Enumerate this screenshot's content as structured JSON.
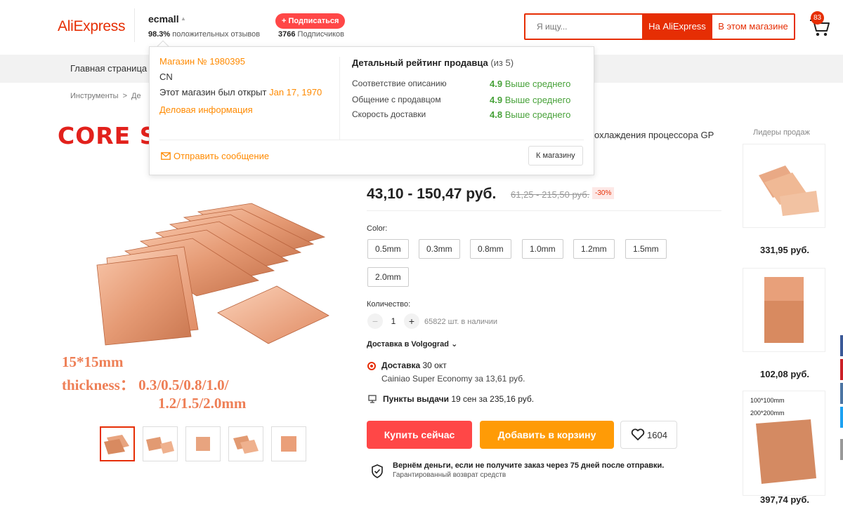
{
  "header": {
    "logo": "AliExpress",
    "store_name": "ecmall",
    "store_rating_value": "98.3%",
    "store_rating_label": "положительных отзывов",
    "subscribe_label": "+ Подписаться",
    "subscribers_value": "3766",
    "subscribers_label": "Подписчиков",
    "search_placeholder": "Я ищу...",
    "search_aliexpress": "На AliExpress",
    "search_store": "В этом магазине",
    "cart_count": "83"
  },
  "nav": {
    "home": "Главная страница"
  },
  "breadcrumb": {
    "item1": "Инструменты",
    "sep": ">",
    "item2": "Де"
  },
  "gallery": {
    "banner_text": "CORE SU",
    "text1": "15*15mm",
    "text2": "thickness： 0.3/0.5/0.8/1.0/",
    "text3": "1.2/1.5/2.0mm"
  },
  "product": {
    "title_partial": "охлаждения процессора GP",
    "price": "43,10 - 150,47 руб.",
    "price_old": "61,25 - 215,50 руб.",
    "discount": "-30%",
    "color_label": "Color:",
    "options": [
      "0.5mm",
      "0.3mm",
      "0.8mm",
      "1.0mm",
      "1.2mm",
      "1.5mm",
      "2.0mm"
    ],
    "qty_label": "Количество:",
    "qty_minus": "−",
    "qty_value": "1",
    "qty_plus": "+",
    "stock": "65822 шт. в наличии",
    "ship_to": "Доставка в Volgograd",
    "ship_title": "Доставка",
    "ship_date": "30 окт",
    "ship_method": "Cainiao Super Economy за 13,61 руб.",
    "pickup_title": "Пункты выдачи",
    "pickup_detail": "19 сен за 235,16 руб.",
    "buy_now": "Купить сейчас",
    "add_to_cart": "Добавить в корзину",
    "wishlist_count": "1604",
    "guarantee_title": "Вернём деньги, если не получите заказ через 75 дней после отправки.",
    "guarantee_sub": "Гарантированный возврат средств"
  },
  "bestsellers": {
    "title": "Лидеры продаж",
    "items": [
      {
        "price": "331,95 руб."
      },
      {
        "price": "102,08 руб."
      },
      {
        "price": "397,74 руб.",
        "label1": "100*100mm",
        "label2": "200*200mm"
      }
    ]
  },
  "store_popup": {
    "store_no": "Магазин № 1980395",
    "country": "CN",
    "opened_label": "Этот магазин был открыт",
    "opened_date": "Jan 17, 1970",
    "business_info": "Деловая информация",
    "rating_title": "Детальный рейтинг продавца",
    "rating_scale": "(из 5)",
    "ratings": [
      {
        "label": "Соответствие описанию",
        "score": "4.9",
        "note": "Выше среднего"
      },
      {
        "label": "Общение с продавцом",
        "score": "4.9",
        "note": "Выше среднего"
      },
      {
        "label": "Скорость доставки",
        "score": "4.8",
        "note": "Выше среднего"
      }
    ],
    "send_message": "Отправить сообщение",
    "to_store": "К магазину"
  },
  "colors": {
    "brand": "#e62e04",
    "buy": "#ff4747",
    "cart": "#ff9b06",
    "popup_link": "#ff8a00",
    "rating_good": "#48a23a"
  }
}
